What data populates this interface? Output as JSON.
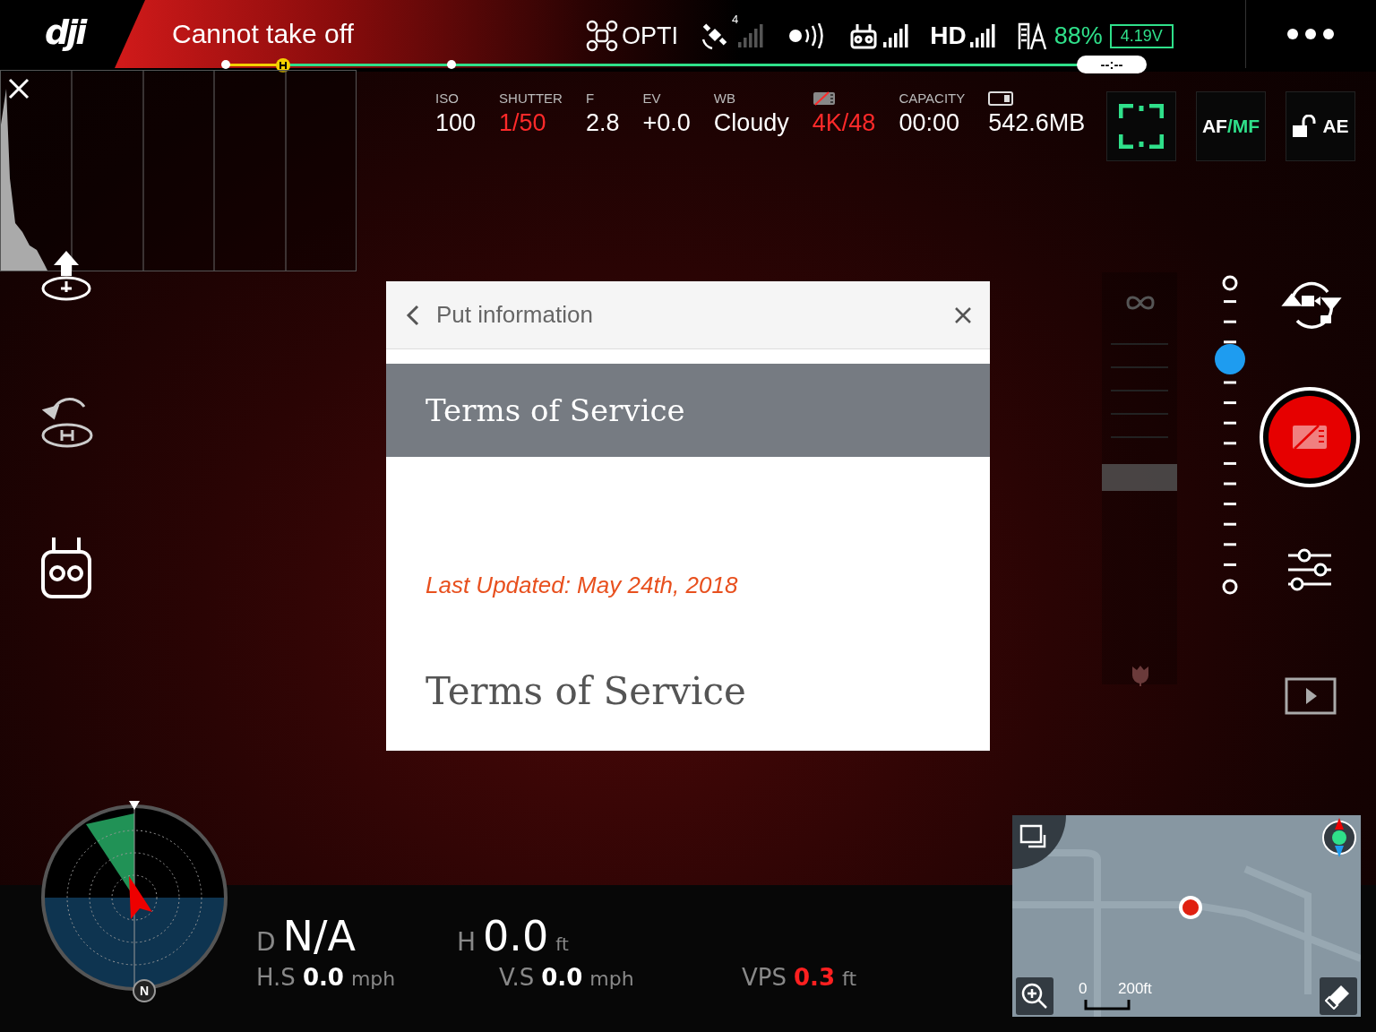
{
  "top_bar": {
    "logo": "dji",
    "status": "Cannot take off",
    "flight_mode": "OPTI",
    "satellite_count": "4",
    "hd_label": "HD",
    "battery_percent": "88%",
    "battery_voltage": "4.19V",
    "flight_time": "--:--"
  },
  "camera_settings": [
    {
      "kind": "text",
      "label": "ISO",
      "value": "100",
      "warning": false
    },
    {
      "kind": "text",
      "label": "SHUTTER",
      "value": "1/50",
      "warning": true
    },
    {
      "kind": "text",
      "label": "F",
      "value": "2.8",
      "warning": false
    },
    {
      "kind": "text",
      "label": "EV",
      "value": "+0.0",
      "warning": false
    },
    {
      "kind": "text",
      "label": "WB",
      "value": "Cloudy",
      "warning": false
    },
    {
      "kind": "sd_icon",
      "value": "4K/48",
      "warning": true
    },
    {
      "kind": "text",
      "label": "CAPACITY",
      "value": "00:00",
      "warning": false
    },
    {
      "kind": "storage_icon",
      "value": "542.6MB",
      "warning": false
    }
  ],
  "camera_buttons": {
    "af": "AF",
    "mf": "/MF",
    "ae": "AE"
  },
  "dialog": {
    "title": "Put information",
    "banner": "Terms of Service",
    "last_updated": "Last Updated: May 24th, 2018",
    "heading": "Terms of Service"
  },
  "zoom_slider": {
    "level": 0.75
  },
  "telemetry": [
    {
      "kind": "large",
      "label": "D",
      "value": "N/A",
      "warning": false
    },
    {
      "kind": "large",
      "label": "H",
      "value": "0.0",
      "unit": "ft",
      "warning": false
    },
    {
      "kind": "small",
      "label": "H.S",
      "value": "0.0",
      "unit": "mph",
      "warning": false
    },
    {
      "kind": "small",
      "label": "V.S",
      "value": "0.0",
      "unit": "mph",
      "warning": false
    },
    {
      "kind": "small",
      "label": "VPS",
      "value": "0.3",
      "unit": "ft",
      "warning": true
    }
  ],
  "compass": {
    "north": "N"
  },
  "map": {
    "scale_start": "0",
    "scale_end": "200ft"
  }
}
